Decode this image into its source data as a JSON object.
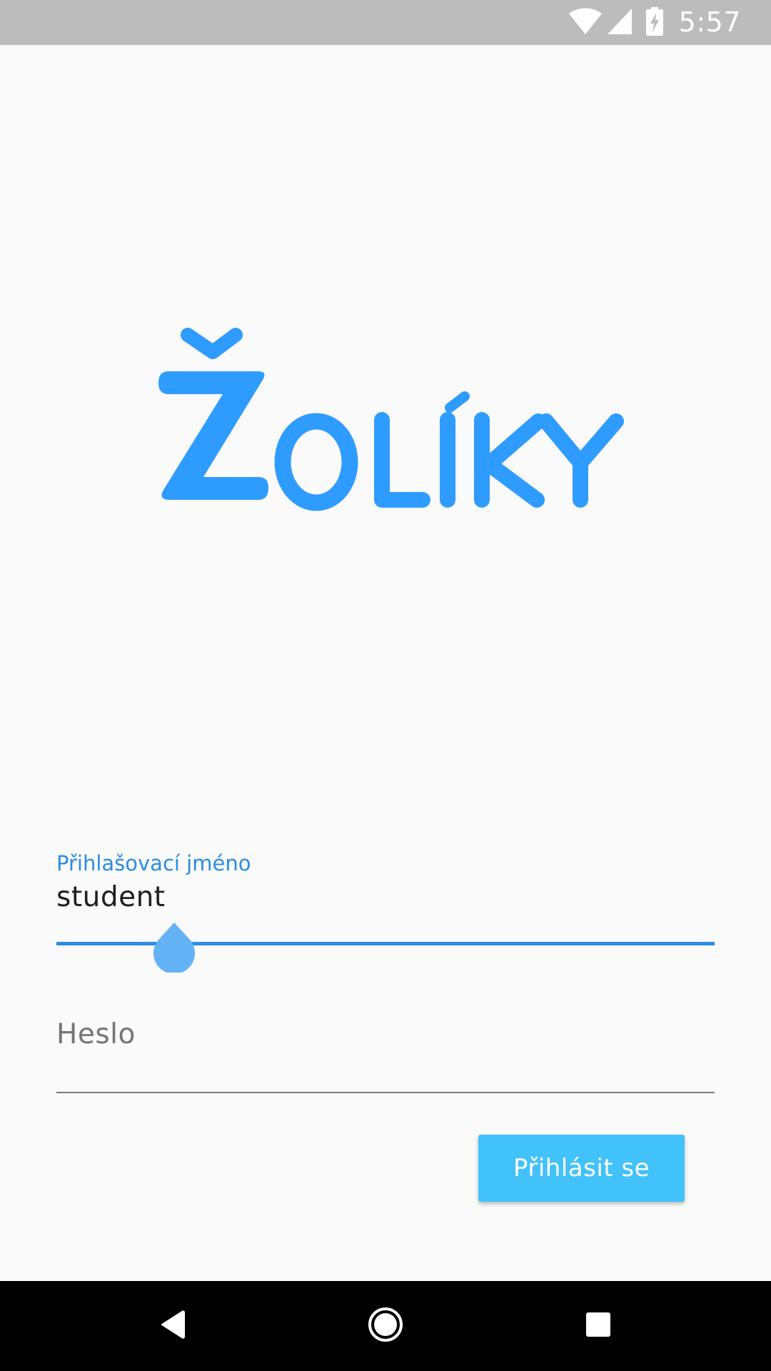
{
  "status_bar": {
    "time": "5:57",
    "icons": [
      "wifi-icon",
      "cell-signal-icon",
      "battery-charging-icon"
    ],
    "background": "#bcbcbc"
  },
  "logo": {
    "text": "ŽOLÍKY",
    "color": "#2e9cff"
  },
  "form": {
    "username": {
      "label": "Přihlašovací jméno",
      "value": "student",
      "focused": true,
      "accent": "#2a8de4"
    },
    "password": {
      "placeholder": "Heslo",
      "value": ""
    },
    "login_button": {
      "label": "Přihlásit se",
      "color": "#42c2fb"
    }
  },
  "nav_bar": {
    "buttons": [
      "back-icon",
      "home-icon",
      "recents-icon"
    ]
  }
}
